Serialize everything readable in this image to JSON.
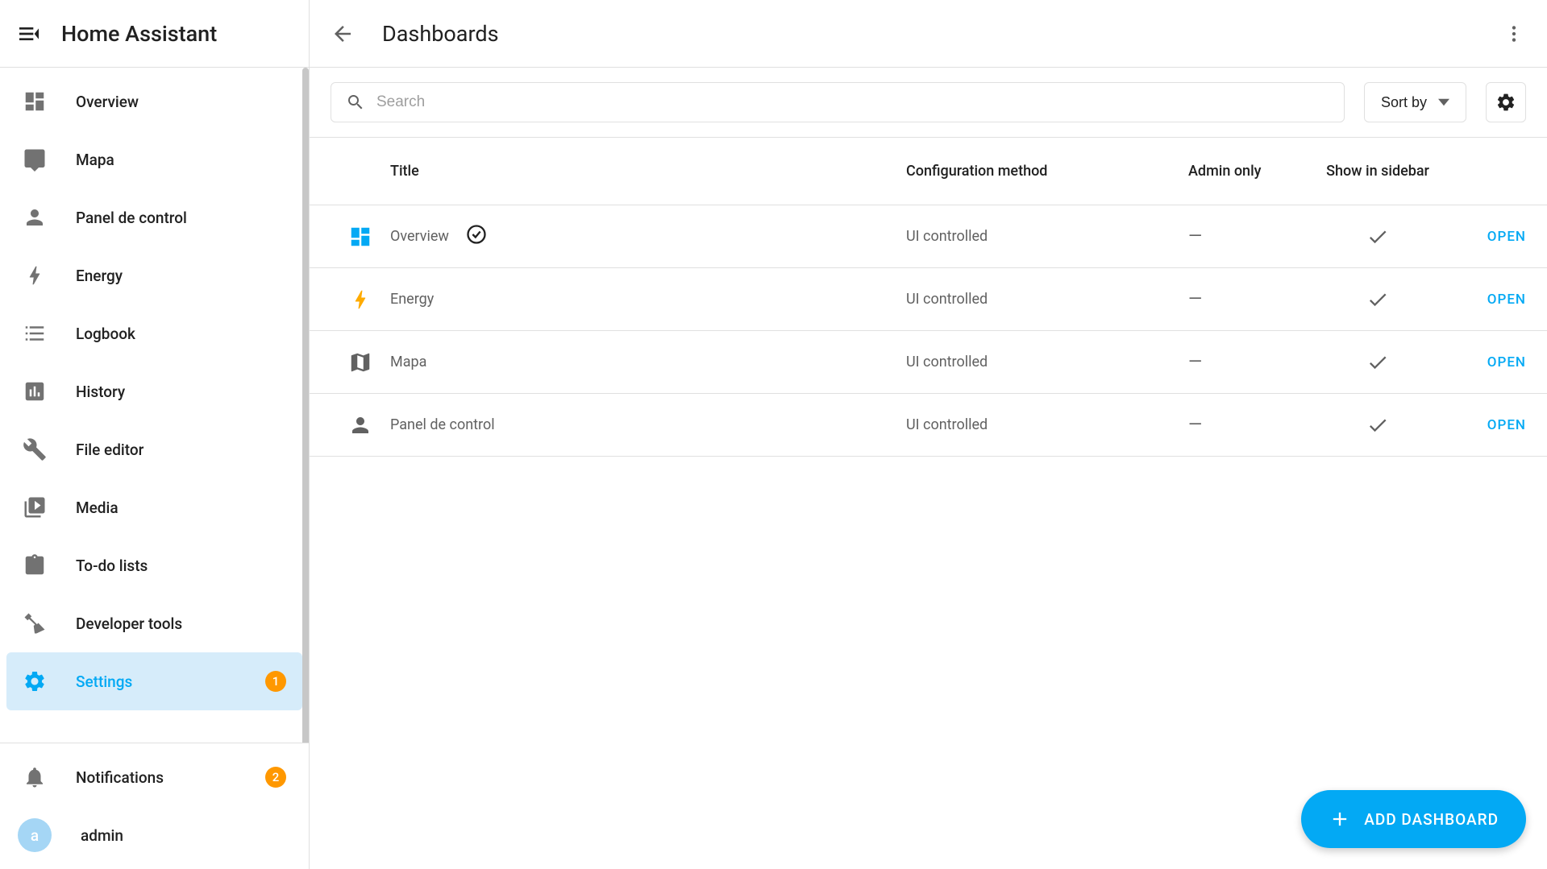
{
  "app_name": "Home Assistant",
  "page_title": "Dashboards",
  "search": {
    "placeholder": "Search"
  },
  "sort_label": "Sort by",
  "fab_label": "ADD DASHBOARD",
  "sidebar": {
    "items": [
      {
        "icon": "dashboard",
        "label": "Overview"
      },
      {
        "icon": "map-speech",
        "label": "Mapa"
      },
      {
        "icon": "person",
        "label": "Panel de control"
      },
      {
        "icon": "bolt",
        "label": "Energy"
      },
      {
        "icon": "list",
        "label": "Logbook"
      },
      {
        "icon": "chart",
        "label": "History"
      },
      {
        "icon": "wrench",
        "label": "File editor"
      },
      {
        "icon": "play",
        "label": "Media"
      },
      {
        "icon": "clipboard",
        "label": "To-do lists"
      },
      {
        "icon": "hammer",
        "label": "Developer tools"
      },
      {
        "icon": "gear",
        "label": "Settings",
        "active": true,
        "badge": "1"
      }
    ],
    "notifications": {
      "label": "Notifications",
      "badge": "2"
    },
    "user": {
      "initial": "a",
      "name": "admin"
    }
  },
  "table": {
    "headers": {
      "title": "Title",
      "config": "Configuration method",
      "admin": "Admin only",
      "sidebar": "Show in sidebar"
    },
    "open_label": "OPEN",
    "rows": [
      {
        "icon": "dashboard",
        "icon_color": "#03a9f4",
        "title": "Overview",
        "default": true,
        "config": "UI controlled",
        "admin": "—",
        "sidebar": true
      },
      {
        "icon": "bolt",
        "icon_color": "#ffab00",
        "title": "Energy",
        "config": "UI controlled",
        "admin": "—",
        "sidebar": true
      },
      {
        "icon": "map",
        "icon_color": "#616161",
        "title": "Mapa",
        "config": "UI controlled",
        "admin": "—",
        "sidebar": true
      },
      {
        "icon": "person",
        "icon_color": "#616161",
        "title": "Panel de control",
        "config": "UI controlled",
        "admin": "—",
        "sidebar": true
      }
    ]
  }
}
